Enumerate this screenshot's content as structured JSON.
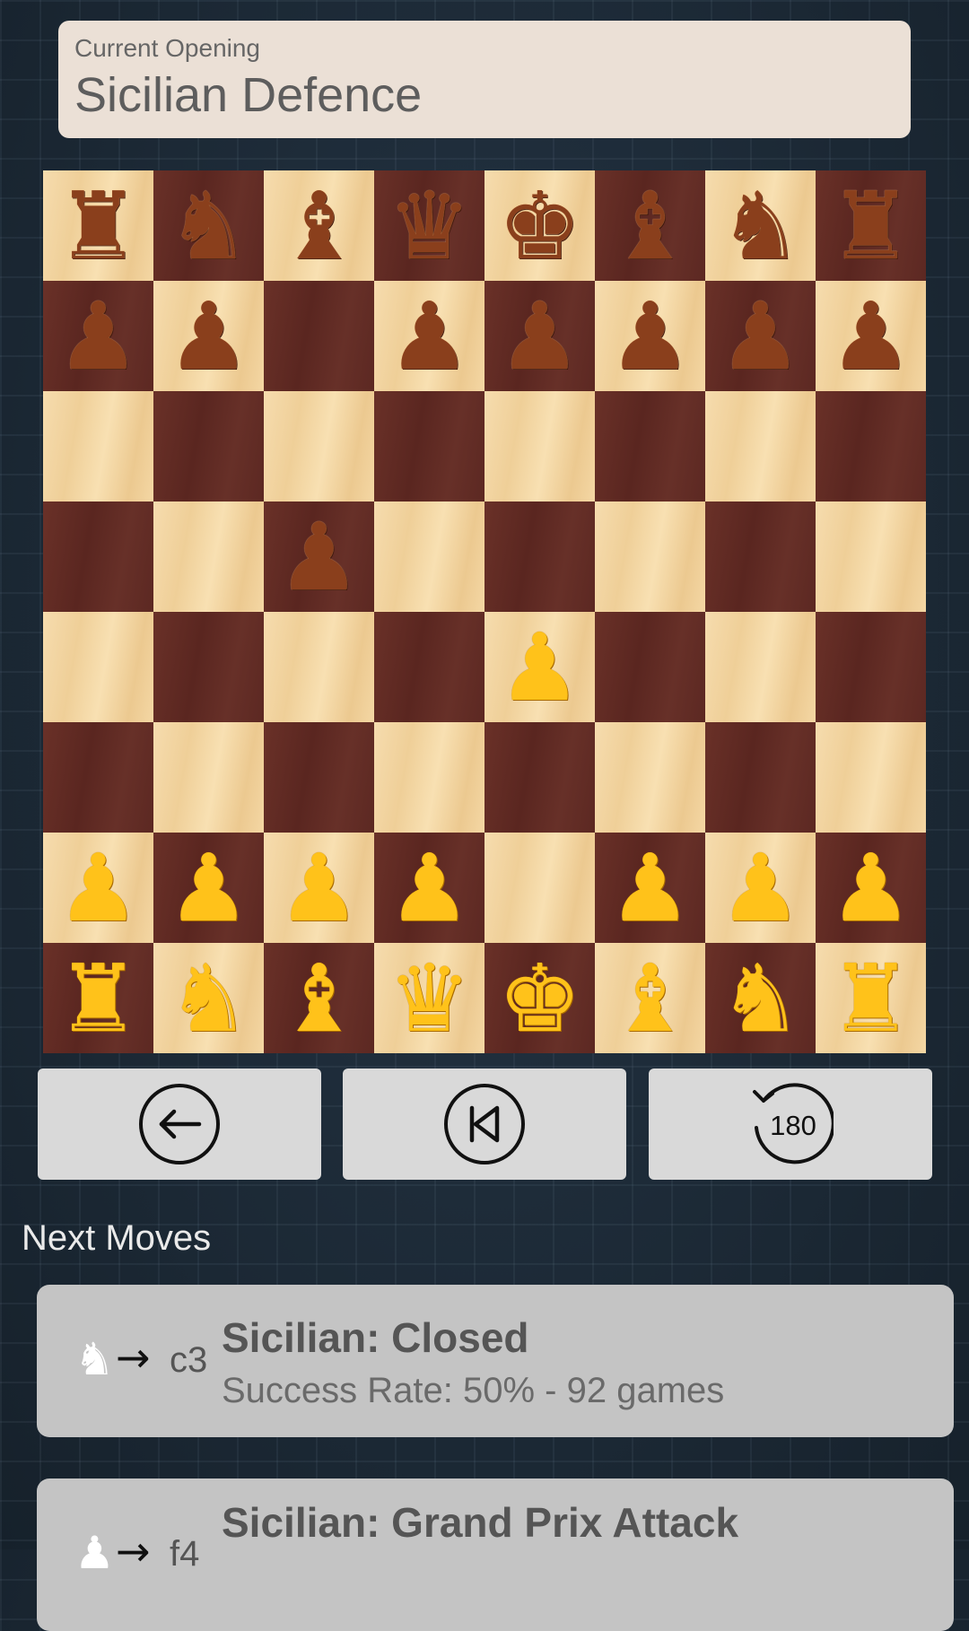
{
  "opening": {
    "label": "Current Opening",
    "name": "Sicilian Defence"
  },
  "board": {
    "squares": [
      [
        {
          "p": "♜",
          "c": "black"
        },
        {
          "p": "♞",
          "c": "black"
        },
        {
          "p": "♝",
          "c": "black"
        },
        {
          "p": "♛",
          "c": "black"
        },
        {
          "p": "♚",
          "c": "black"
        },
        {
          "p": "♝",
          "c": "black"
        },
        {
          "p": "♞",
          "c": "black"
        },
        {
          "p": "♜",
          "c": "black"
        }
      ],
      [
        {
          "p": "♟",
          "c": "black"
        },
        {
          "p": "♟",
          "c": "black"
        },
        null,
        {
          "p": "♟",
          "c": "black"
        },
        {
          "p": "♟",
          "c": "black"
        },
        {
          "p": "♟",
          "c": "black"
        },
        {
          "p": "♟",
          "c": "black"
        },
        {
          "p": "♟",
          "c": "black"
        }
      ],
      [
        null,
        null,
        null,
        null,
        null,
        null,
        null,
        null
      ],
      [
        null,
        null,
        {
          "p": "♟",
          "c": "black"
        },
        null,
        null,
        null,
        null,
        null
      ],
      [
        null,
        null,
        null,
        null,
        {
          "p": "♟",
          "c": "white"
        },
        null,
        null,
        null
      ],
      [
        null,
        null,
        null,
        null,
        null,
        null,
        null,
        null
      ],
      [
        {
          "p": "♟",
          "c": "white"
        },
        {
          "p": "♟",
          "c": "white"
        },
        {
          "p": "♟",
          "c": "white"
        },
        {
          "p": "♟",
          "c": "white"
        },
        null,
        {
          "p": "♟",
          "c": "white"
        },
        {
          "p": "♟",
          "c": "white"
        },
        {
          "p": "♟",
          "c": "white"
        }
      ],
      [
        {
          "p": "♜",
          "c": "white"
        },
        {
          "p": "♞",
          "c": "white"
        },
        {
          "p": "♝",
          "c": "white"
        },
        {
          "p": "♛",
          "c": "white"
        },
        {
          "p": "♚",
          "c": "white"
        },
        {
          "p": "♝",
          "c": "white"
        },
        {
          "p": "♞",
          "c": "white"
        },
        {
          "p": "♜",
          "c": "white"
        }
      ]
    ]
  },
  "controls": {
    "back_icon": "back-arrow-icon",
    "first_icon": "skip-to-start-icon",
    "rotate_icon": "rotate-180-icon",
    "rotate_label": "180"
  },
  "next_moves": {
    "title": "Next Moves",
    "items": [
      {
        "piece_icon": "♞",
        "arrow": "→",
        "square": "c3",
        "name": "Sicilian: Closed",
        "stats": "Success Rate: 50% - 92 games"
      },
      {
        "piece_icon": "♟",
        "arrow": "→",
        "square": "f4",
        "name": "Sicilian: Grand Prix Attack",
        "stats": ""
      }
    ]
  },
  "colors": {
    "light_square": "#f3d7a4",
    "dark_square": "#5e2922",
    "black_piece": "#8a3f1c",
    "white_piece": "#ffc21a",
    "card_bg": "#ebe0d6",
    "button_bg": "#d9d9d9"
  }
}
